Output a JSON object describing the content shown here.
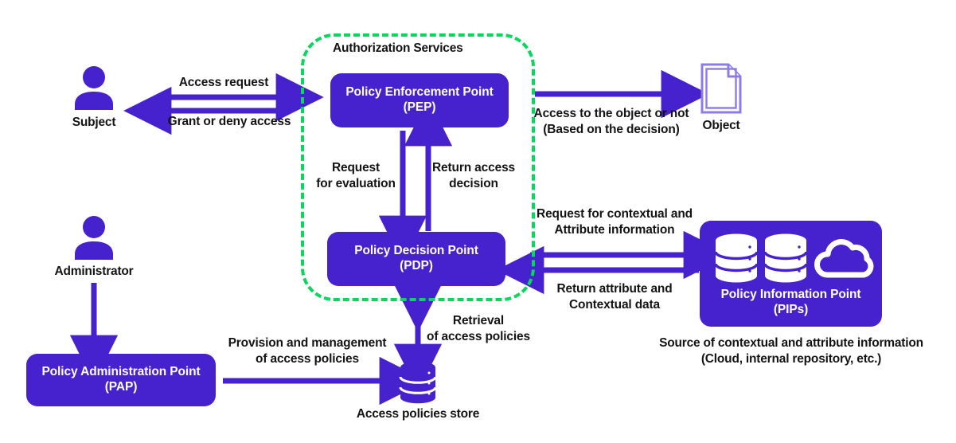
{
  "diagram": {
    "title": "Access control architecture (PEP / PDP / PAP / PIP)",
    "colors": {
      "primary_purple": "#4621CE",
      "arrow_purple": "#4621CE",
      "group_green": "#07D75C",
      "object_outline": "#8C7CE8",
      "text": "#141414",
      "background": "#FFFFFF"
    }
  },
  "group": {
    "name": "authorization-services",
    "title": "Authorization Services"
  },
  "nodes": {
    "pep": {
      "line1": "Policy Enforcement Point",
      "line2": "(PEP)"
    },
    "pdp": {
      "line1": "Policy Decision Point",
      "line2": "(PDP)"
    },
    "pap": {
      "line1": "Policy Administration Point",
      "line2": "(PAP)"
    },
    "pip": {
      "line1": "Policy Information Point",
      "line2": "(PIPs)"
    },
    "subject": {
      "label": "Subject",
      "icon": "person-icon"
    },
    "administrator": {
      "label": "Administrator",
      "icon": "person-icon"
    },
    "object": {
      "label": "Object",
      "icon": "document-icon"
    },
    "policy_store": {
      "label": "Access policies store",
      "icon": "database-icon"
    }
  },
  "captions": {
    "pip_source": "Source of contextual and attribute information\n(Cloud, internal repository, etc.)"
  },
  "edges": {
    "access_request": "Access request",
    "grant_or_deny": "Grant or deny access",
    "access_to_object": "Access to the object or not\n(Based on the decision)",
    "request_for_evaluation": "Request\nfor evaluation",
    "return_access_decision": "Return access\ndecision",
    "request_contextual": "Request for contextual and\nAttribute information",
    "return_attribute": "Return attribute and\nContextual data",
    "provision_management": "Provision and management\nof access policies",
    "retrieval_policies": "Retrieval\nof access policies"
  }
}
